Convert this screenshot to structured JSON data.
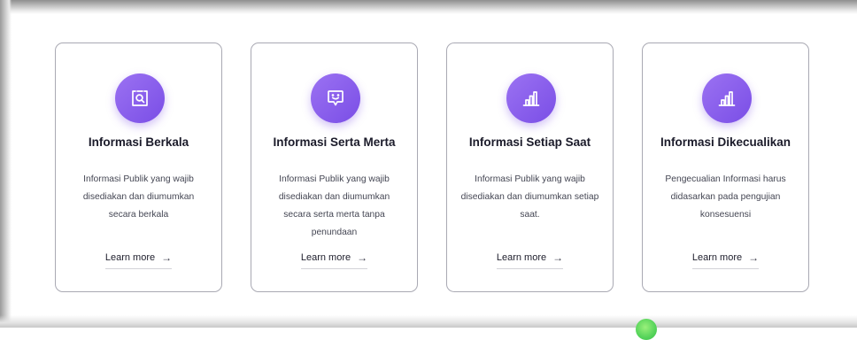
{
  "cards": [
    {
      "title": "Informasi Berkala",
      "icon": "search-document-icon",
      "description": "Informasi Publik yang wajib disediakan dan diumumkan secara berkala",
      "link": "Learn more"
    },
    {
      "title": "Informasi Serta Merta",
      "icon": "chat-smile-icon",
      "description": "Informasi Publik yang wajib disediakan dan diumumkan secara serta merta tanpa penundaan",
      "link": "Learn more"
    },
    {
      "title": "Informasi Setiap Saat",
      "icon": "bar-chart-icon",
      "description": "Informasi Publik yang wajib disediakan dan diumumkan setiap saat.",
      "link": "Learn more"
    },
    {
      "title": "Informasi Dikecualikan",
      "icon": "bar-chart-icon",
      "description": "Pengecualian Informasi harus didasarkan pada pengujian konsesuensi",
      "link": "Learn more"
    }
  ],
  "arrow_glyph": "→",
  "colors": {
    "accent": "#7a4ee6",
    "accent_light": "#9b72f2",
    "card_border": "#a9a9b3",
    "title_text": "#1b1b2a",
    "body_text": "#444653",
    "green_dot": "#55d35a"
  }
}
